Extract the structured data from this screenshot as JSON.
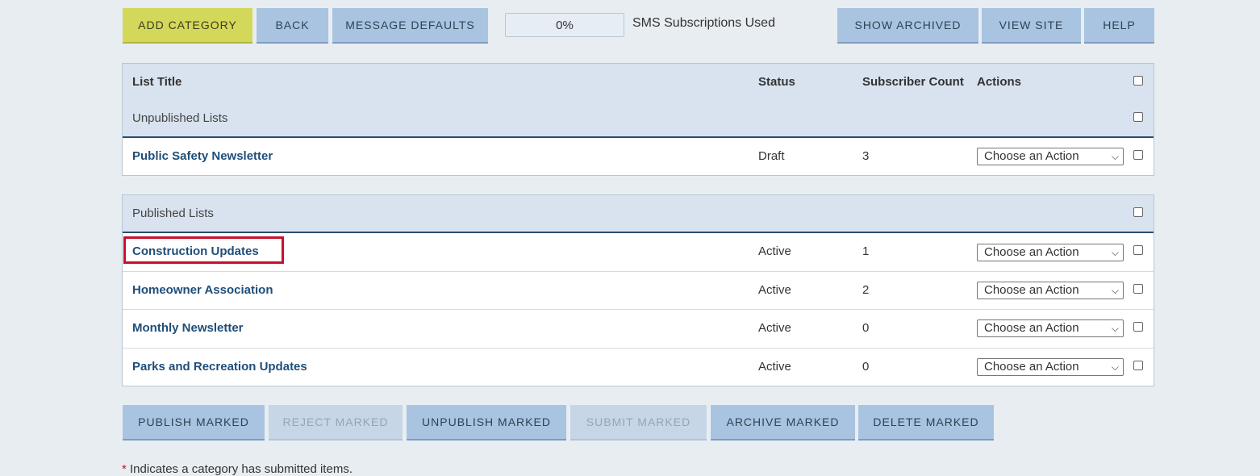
{
  "toolbar": {
    "add_category": "ADD CATEGORY",
    "back": "BACK",
    "message_defaults": "MESSAGE DEFAULTS",
    "sms_progress": "0%",
    "sms_label": "SMS Subscriptions Used",
    "show_archived": "SHOW ARCHIVED",
    "view_site": "VIEW SITE",
    "help": "HELP"
  },
  "table": {
    "headers": {
      "title": "List Title",
      "status": "Status",
      "subscribers": "Subscriber Count",
      "actions": "Actions"
    },
    "unpublished_group": "Unpublished Lists",
    "unpublished_rows": [
      {
        "title": "Public Safety Newsletter",
        "status": "Draft",
        "count": "3",
        "action": "Choose an Action"
      }
    ],
    "published_group": "Published Lists",
    "published_rows": [
      {
        "title": "Construction Updates",
        "status": "Active",
        "count": "1",
        "action": "Choose an Action"
      },
      {
        "title": "Homeowner Association",
        "status": "Active",
        "count": "2",
        "action": "Choose an Action"
      },
      {
        "title": "Monthly Newsletter",
        "status": "Active",
        "count": "0",
        "action": "Choose an Action"
      },
      {
        "title": "Parks and Recreation Updates",
        "status": "Active",
        "count": "0",
        "action": "Choose an Action"
      }
    ]
  },
  "bulk": {
    "publish": "PUBLISH MARKED",
    "reject": "REJECT MARKED",
    "unpublish": "UNPUBLISH MARKED",
    "submit": "SUBMIT MARKED",
    "archive": "ARCHIVE MARKED",
    "delete": "DELETE MARKED"
  },
  "footnote": {
    "star": "*",
    "text": " Indicates a category has submitted items."
  },
  "colors": {
    "accent_button": "#d4d85a",
    "button": "#a9c4e0",
    "highlight": "#c8102e",
    "link": "#1f4e79"
  }
}
